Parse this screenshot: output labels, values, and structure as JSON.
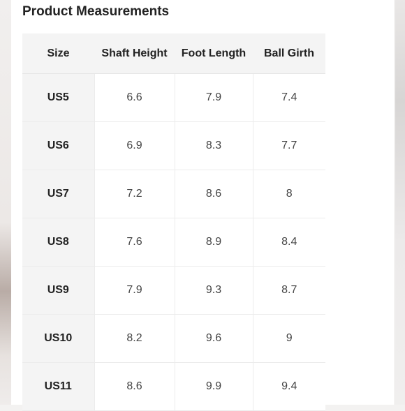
{
  "title": "Product Measurements",
  "table": {
    "headers": [
      "Size",
      "Shaft Height",
      "Foot Length",
      "Ball Girth"
    ],
    "rows": [
      [
        "US5",
        "6.6",
        "7.9",
        "7.4"
      ],
      [
        "US6",
        "6.9",
        "8.3",
        "7.7"
      ],
      [
        "US7",
        "7.2",
        "8.6",
        "8"
      ],
      [
        "US8",
        "7.6",
        "8.9",
        "8.4"
      ],
      [
        "US9",
        "7.9",
        "9.3",
        "8.7"
      ],
      [
        "US10",
        "8.2",
        "9.6",
        "9"
      ],
      [
        "US11",
        "8.6",
        "9.9",
        "9.4"
      ]
    ]
  }
}
